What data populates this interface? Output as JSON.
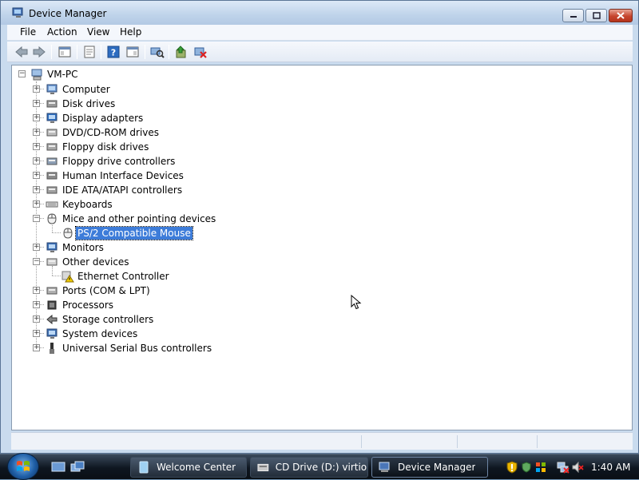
{
  "window": {
    "title": "Device Manager"
  },
  "menu": {
    "file": "File",
    "action": "Action",
    "view": "View",
    "help": "Help"
  },
  "toolbar": {
    "icons": [
      "back-arrow-icon",
      "forward-arrow-icon",
      "show-hide-console-tree-icon",
      "properties-icon",
      "help-icon",
      "help-topics-icon",
      "scan-hardware-changes-icon",
      "update-driver-icon",
      "uninstall-device-icon"
    ]
  },
  "tree": {
    "root": "VM-PC",
    "categories": [
      {
        "label": "Computer",
        "icon": "computer-icon",
        "expanded": false
      },
      {
        "label": "Disk drives",
        "icon": "disk-drive-icon",
        "expanded": false
      },
      {
        "label": "Display adapters",
        "icon": "display-adapter-icon",
        "expanded": false
      },
      {
        "label": "DVD/CD-ROM drives",
        "icon": "dvd-drive-icon",
        "expanded": false
      },
      {
        "label": "Floppy disk drives",
        "icon": "floppy-drive-icon",
        "expanded": false
      },
      {
        "label": "Floppy drive controllers",
        "icon": "floppy-controller-icon",
        "expanded": false
      },
      {
        "label": "Human Interface Devices",
        "icon": "hid-icon",
        "expanded": false
      },
      {
        "label": "IDE ATA/ATAPI controllers",
        "icon": "ide-controller-icon",
        "expanded": false
      },
      {
        "label": "Keyboards",
        "icon": "keyboard-icon",
        "expanded": false
      },
      {
        "label": "Mice and other pointing devices",
        "icon": "mouse-icon",
        "expanded": true
      },
      {
        "label": "PS/2 Compatible Mouse",
        "icon": "mouse-icon",
        "child": true,
        "selected": true
      },
      {
        "label": "Monitors",
        "icon": "monitor-icon",
        "expanded": false
      },
      {
        "label": "Other devices",
        "icon": "unknown-device-icon",
        "expanded": true
      },
      {
        "label": "Ethernet Controller",
        "icon": "warning-device-icon",
        "child": true
      },
      {
        "label": "Ports (COM & LPT)",
        "icon": "port-icon",
        "expanded": false
      },
      {
        "label": "Processors",
        "icon": "processor-icon",
        "expanded": false
      },
      {
        "label": "Storage controllers",
        "icon": "storage-controller-icon",
        "expanded": false
      },
      {
        "label": "System devices",
        "icon": "system-device-icon",
        "expanded": false
      },
      {
        "label": "Universal Serial Bus controllers",
        "icon": "usb-icon",
        "expanded": false
      }
    ]
  },
  "taskbar": {
    "tasks": [
      {
        "label": "Welcome Center",
        "icon": "welcome-center-icon"
      },
      {
        "label": "CD Drive (D:) virtio...",
        "icon": "cd-drive-icon"
      },
      {
        "label": "Device Manager",
        "icon": "device-manager-icon",
        "active": true
      }
    ],
    "clock": "1:40 AM"
  },
  "colors": {
    "selection": "#3d7cd9",
    "window_frame": "#c9dbee",
    "taskbar": "#0e1620"
  }
}
